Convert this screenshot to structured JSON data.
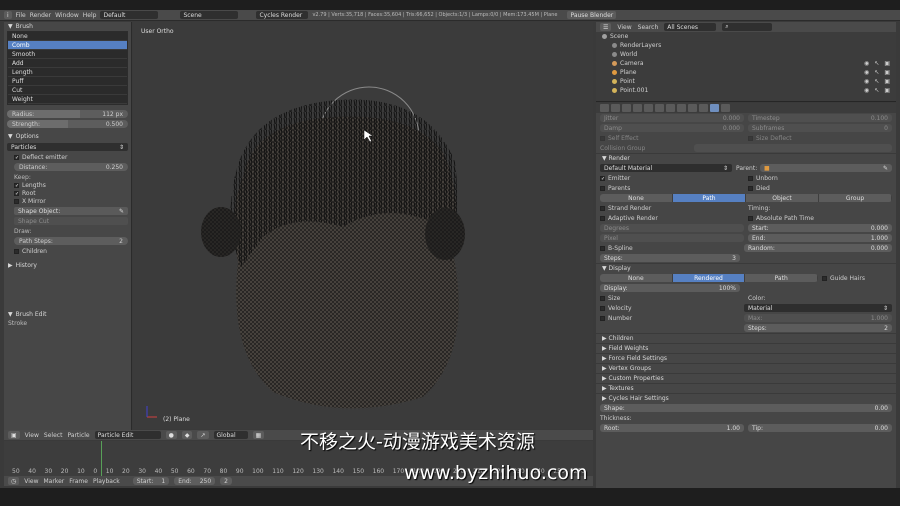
{
  "topbar": {
    "menus": [
      "File",
      "Render",
      "Window",
      "Help"
    ],
    "layout": "Default",
    "scene": "Scene",
    "engine": "Cycles Render",
    "stats": "v2.79 | Verts:35,718 | Faces:35,604 | Tris:66,652 | Objects:1/3 | Lamps:0/0 | Mem:173.45M | Plane",
    "pause_button": "Pause Blender"
  },
  "toolshelf": {
    "brush_header": "Brush",
    "brushes": [
      "None",
      "Comb",
      "Smooth",
      "Add",
      "Length",
      "Puff",
      "Cut",
      "Weight"
    ],
    "active_brush": "Comb",
    "radius_label": "Radius:",
    "radius_value": "112 px",
    "radius_fill_fraction": 0.6,
    "strength_label": "Strength:",
    "strength_value": "0.500",
    "strength_fill_fraction": 0.5,
    "options_header": "Options",
    "edit_type": "Particles",
    "deflect_label": "Deflect emitter",
    "distance_label": "Distance:",
    "distance_value": "0.250",
    "keep_label": "Keep:",
    "lengths_label": "Lengths",
    "root_label": "Root",
    "xmirror_label": "X Mirror",
    "shape_object_label": "Shape Object:",
    "shape_cut_label": "Shape Cut",
    "draw_label": "Draw:",
    "path_steps_label": "Path Steps:",
    "path_steps_value": "2",
    "children_label": "Children",
    "history_header": "History",
    "brush_edit_header": "Brush Edit",
    "stroke_label": "Stroke"
  },
  "viewport": {
    "view_label": "User Ortho",
    "object_label": "(2) Plane"
  },
  "viewport_header": {
    "menus": [
      "View",
      "Select",
      "Particle"
    ],
    "mode": "Particle Edit",
    "orientation": "Global"
  },
  "timeline": {
    "ruler": [
      "50",
      "40",
      "30",
      "20",
      "10",
      "0",
      "10",
      "20",
      "30",
      "40",
      "50",
      "60",
      "70",
      "80",
      "90",
      "100",
      "110",
      "120",
      "130",
      "140",
      "150",
      "160",
      "170",
      "180",
      "190",
      "200",
      "210",
      "220",
      "230",
      "240",
      "250",
      "260"
    ],
    "menus": [
      "View",
      "Marker",
      "Frame",
      "Playback"
    ],
    "start_label": "Start:",
    "start_value": "1",
    "end_label": "End:",
    "end_value": "250",
    "current_frame": "2"
  },
  "outliner": {
    "menus": [
      "View",
      "Search"
    ],
    "filter": "All Scenes",
    "items": [
      {
        "label": "Scene",
        "color": "#a0a0a0",
        "indent": 0
      },
      {
        "label": "RenderLayers",
        "color": "#8a8a8a",
        "indent": 1
      },
      {
        "label": "World",
        "color": "#8a8a8a",
        "indent": 1
      },
      {
        "label": "Camera",
        "color": "#d49a5a",
        "indent": 1
      },
      {
        "label": "Plane",
        "color": "#e09a40",
        "indent": 1
      },
      {
        "label": "Point",
        "color": "#d4b45a",
        "indent": 1
      },
      {
        "label": "Point.001",
        "color": "#d4b45a",
        "indent": 1
      }
    ]
  },
  "properties": {
    "top_rows": [
      {
        "left": "Jitter",
        "left_value": "0.000",
        "right": "Timestep",
        "right_value": "0.100"
      },
      {
        "left": "Damp",
        "left_value": "0.000",
        "right": "Subframes",
        "right_value": "0"
      }
    ],
    "self_effect_label": "Self Effect",
    "size_deflect_label": "Size Deflect",
    "collision_label": "Collision Group",
    "render_header": "Render",
    "material": "Default Material",
    "parent_label": "Parent:",
    "emitter_label": "Emitter",
    "unborn_label": "Unborn",
    "parents_label": "Parents",
    "died_label": "Died",
    "render_as": [
      "None",
      "Path",
      "Object",
      "Group"
    ],
    "render_as_active": "Path",
    "strand_label": "Strand Render",
    "adaptive_label": "Adaptive Render",
    "degrees_label": "Degrees",
    "pixel_label": "Pixel",
    "timing_label": "Timing:",
    "abs_time_label": "Absolute Path Time",
    "start_label": "Start:",
    "start_value": "0.000",
    "end_label": "End:",
    "end_value": "1.000",
    "random_label": "Random:",
    "random_value": "0.000",
    "bspline_label": "B-Spline",
    "steps_label": "Steps:",
    "steps_value": "3",
    "display_header": "Display",
    "display_as": [
      "None",
      "Rendered",
      "Path"
    ],
    "display_as_active": "Rendered",
    "guide_label": "Guide Hairs",
    "display_label": "Display:",
    "display_value": "100%",
    "size_label": "Size",
    "velocity_label": "Velocity",
    "number_label": "Number",
    "color_label": "Color:",
    "color_value": "Material",
    "max_label": "Max:",
    "max_value": "1.000",
    "dsteps_label": "Steps:",
    "dsteps_value": "2",
    "collapsed": [
      "Children",
      "Field Weights",
      "Force Field Settings",
      "Vertex Groups",
      "Custom Properties",
      "Textures",
      "Cycles Hair Settings"
    ],
    "shape_label": "Shape:",
    "shape_value": "0.00",
    "thickness_label": "Thickness:",
    "root_label": "Root:",
    "root_value": "1.00",
    "tip_label": "Tip:",
    "tip_value": "0.00"
  },
  "watermark": {
    "line1": "不移之火-动漫游戏美术资源",
    "line2": "www.byzhihuo.com"
  }
}
